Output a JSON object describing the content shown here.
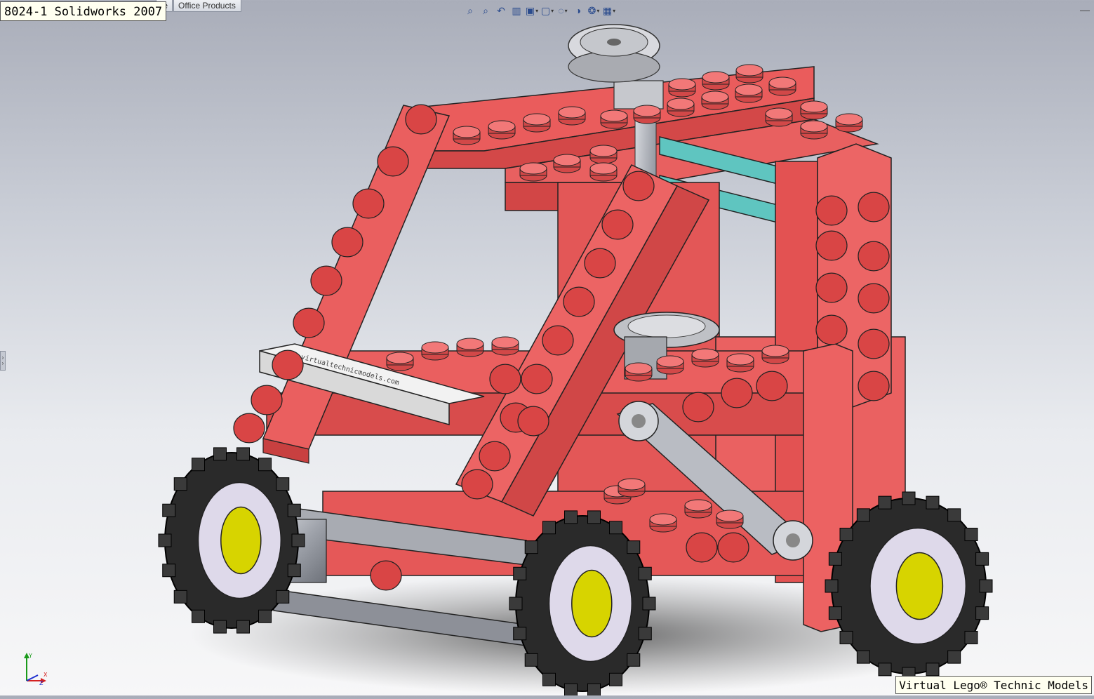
{
  "window": {
    "title": "8024-1 Solidworks 2007"
  },
  "tabs": [
    {
      "label": "te"
    },
    {
      "label": "Office Products"
    }
  ],
  "toolbar": {
    "buttons": [
      {
        "name": "zoom-to-fit",
        "glyph": "⌕",
        "has_dropdown": false
      },
      {
        "name": "zoom-to-area",
        "glyph": "⌕",
        "has_dropdown": false
      },
      {
        "name": "previous-view",
        "glyph": "↶",
        "has_dropdown": false
      },
      {
        "name": "section-view",
        "glyph": "▥",
        "has_dropdown": false
      },
      {
        "name": "view-orientation",
        "glyph": "▣",
        "has_dropdown": true
      },
      {
        "name": "display-style",
        "glyph": "▢",
        "has_dropdown": true
      },
      {
        "name": "hide-show-items",
        "glyph": "◌",
        "has_dropdown": true
      },
      {
        "name": "edit-appearance",
        "glyph": "◑",
        "has_dropdown": false
      },
      {
        "name": "apply-scene",
        "glyph": "❂",
        "has_dropdown": true
      },
      {
        "name": "view-settings",
        "glyph": "▦",
        "has_dropdown": true
      }
    ],
    "window_control_glyph": "—"
  },
  "triad": {
    "y": "Y",
    "x": "X",
    "z": "Z"
  },
  "caption": "Virtual Lego® Technic Models",
  "model": {
    "name": "lego-technic-8024-vehicle",
    "brick_text": "www.virtualtechnicmodels.com",
    "colors": {
      "brick_red": "#ea5a5a",
      "brick_light": "#f27878",
      "brick_shade": "#d24848",
      "stud": "#d94545",
      "teal": "#5fc5c0",
      "grey": "#9a9da3",
      "tire": "#2a2a2a",
      "rim": "#ded9ea",
      "hub": "#d7d400",
      "white": "#ececec"
    }
  }
}
